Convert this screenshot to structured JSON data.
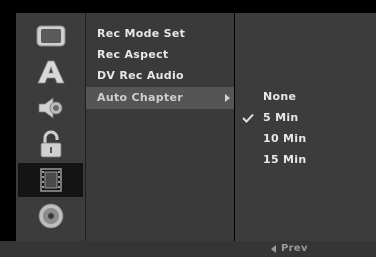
{
  "sidebar": {
    "items": [
      {
        "icon": "tv-screen-icon",
        "active": false
      },
      {
        "icon": "letter-a-icon",
        "active": false
      },
      {
        "icon": "speaker-icon",
        "active": false
      },
      {
        "icon": "padlock-icon",
        "active": false
      },
      {
        "icon": "film-strip-icon",
        "active": true
      },
      {
        "icon": "disc-icon",
        "active": false
      }
    ]
  },
  "menu": {
    "items": [
      {
        "label": "Rec Mode Set"
      },
      {
        "label": "Rec Aspect"
      },
      {
        "label": "DV Rec Audio"
      },
      {
        "label": "Auto Chapter",
        "selected": true
      }
    ]
  },
  "options": {
    "items": [
      {
        "label": "None",
        "checked": false
      },
      {
        "label": "5 Min",
        "checked": true
      },
      {
        "label": "10 Min",
        "checked": false
      },
      {
        "label": "15 Min",
        "checked": false
      }
    ]
  },
  "footer": {
    "hint": "Prev"
  },
  "colors": {
    "background": "#000000",
    "panel": "#3c3c3c",
    "selected_row": "#555555",
    "active_icon_bg": "#141414",
    "text": "#e8e8e8"
  }
}
